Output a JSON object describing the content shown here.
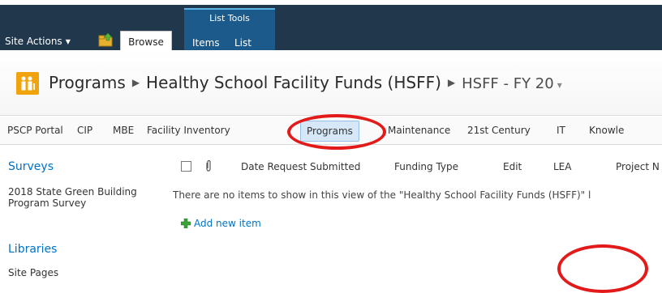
{
  "ribbon": {
    "site_actions": "Site Actions",
    "browse_tab": "Browse",
    "list_tools_label": "List Tools",
    "items_tab": "Items",
    "list_tab": "List",
    "bar_color": "#21374c",
    "contextual_color": "#1c5a8c"
  },
  "breadcrumb": {
    "level1": "Programs",
    "level2": "Healthy School Facility Funds (HSFF)",
    "level3": "HSFF - FY 20",
    "dropdown_glyph": "▾"
  },
  "topnav": {
    "items": [
      "PSCP Portal",
      "CIP",
      "MBE",
      "Facility Inventory",
      "Programs",
      "Maintenance",
      "21st Century",
      "IT",
      "Knowle"
    ],
    "selected": "Programs"
  },
  "quicklaunch": {
    "surveys_heading": "Surveys",
    "survey_link": "2018 State Green Building Program Survey",
    "libraries_heading": "Libraries",
    "site_pages_link": "Site Pages"
  },
  "list": {
    "columns": [
      "Date Request Submitted",
      "Funding Type",
      "Edit",
      "LEA",
      "Project N"
    ],
    "empty_message": "There are no items to show in this view of the \"Healthy School Facility Funds (HSFF)\" l",
    "add_new_item": "Add new item"
  },
  "annotation_color": "#e21a1a"
}
